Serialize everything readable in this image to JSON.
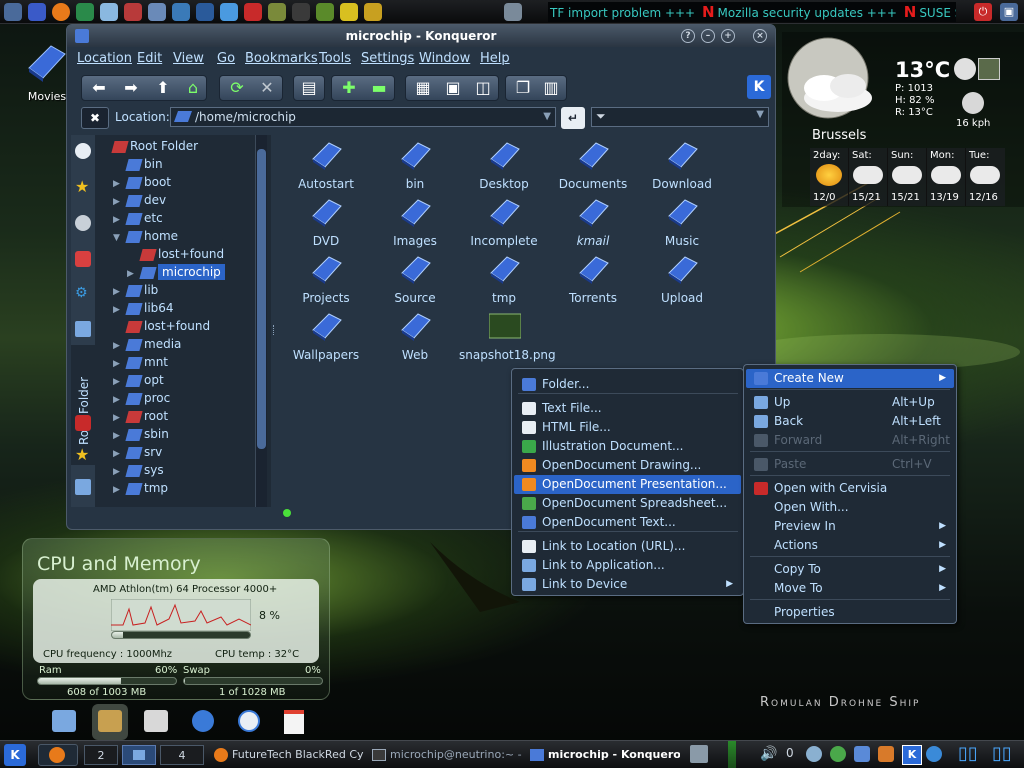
{
  "desktop": {
    "movies_label": "Movies",
    "branding": "Romulan Drohne Ship"
  },
  "topbar": {
    "ticker_prefix": "TF import problem +++",
    "ticker_items": [
      "Mozilla security updates +++",
      "SUSE Security"
    ],
    "ticker_mark": "N"
  },
  "weather": {
    "temperature": "13°C",
    "pressure": "P: 1013",
    "humidity": "H: 82 %",
    "realfeel": "R: 13°C",
    "wind": "16 kph",
    "city": "Brussels",
    "forecast": [
      {
        "day": "2day:",
        "temps": "12/0"
      },
      {
        "day": "Sat:",
        "temps": "15/21"
      },
      {
        "day": "Sun:",
        "temps": "15/21"
      },
      {
        "day": "Mon:",
        "temps": "13/19"
      },
      {
        "day": "Tue:",
        "temps": "12/16"
      }
    ]
  },
  "konqueror": {
    "title": "microchip - Konqueror",
    "menus": [
      "Location",
      "Edit",
      "View",
      "Go",
      "Bookmarks",
      "Tools",
      "Settings",
      "Window",
      "Help"
    ],
    "location_label": "Location:",
    "location_value": "/home/microchip",
    "sidebar_tab": "Root Folder",
    "tree": [
      {
        "label": "Root Folder",
        "level": 0,
        "arrow": ""
      },
      {
        "label": "bin",
        "level": 1,
        "arrow": ""
      },
      {
        "label": "boot",
        "level": 1,
        "arrow": "▶"
      },
      {
        "label": "dev",
        "level": 1,
        "arrow": "▶"
      },
      {
        "label": "etc",
        "level": 1,
        "arrow": "▶"
      },
      {
        "label": "home",
        "level": 1,
        "arrow": "▼"
      },
      {
        "label": "lost+found",
        "level": 2,
        "arrow": ""
      },
      {
        "label": "microchip",
        "level": 2,
        "arrow": "▶"
      },
      {
        "label": "lib",
        "level": 1,
        "arrow": "▶"
      },
      {
        "label": "lib64",
        "level": 1,
        "arrow": "▶"
      },
      {
        "label": "lost+found",
        "level": 1,
        "arrow": ""
      },
      {
        "label": "media",
        "level": 1,
        "arrow": "▶"
      },
      {
        "label": "mnt",
        "level": 1,
        "arrow": "▶"
      },
      {
        "label": "opt",
        "level": 1,
        "arrow": "▶"
      },
      {
        "label": "proc",
        "level": 1,
        "arrow": "▶"
      },
      {
        "label": "root",
        "level": 1,
        "arrow": "▶"
      },
      {
        "label": "sbin",
        "level": 1,
        "arrow": "▶"
      },
      {
        "label": "srv",
        "level": 1,
        "arrow": "▶"
      },
      {
        "label": "sys",
        "level": 1,
        "arrow": "▶"
      },
      {
        "label": "tmp",
        "level": 1,
        "arrow": "▶"
      }
    ],
    "files": [
      "Autostart",
      "bin",
      "Desktop",
      "Documents",
      "Download",
      "DVD",
      "Images",
      "Incomplete",
      "kmail",
      "Music",
      "Projects",
      "Source",
      "tmp",
      "Torrents",
      "Upload",
      "Wallpapers",
      "Web",
      "snapshot18.png"
    ]
  },
  "context_menu": {
    "items": [
      {
        "label": "Create New",
        "shortcut": "",
        "submenu": true,
        "disabled": false,
        "selected": true
      },
      {
        "label": "Up",
        "shortcut": "Alt+Up",
        "submenu": false,
        "disabled": false
      },
      {
        "label": "Back",
        "shortcut": "Alt+Left",
        "submenu": false,
        "disabled": false
      },
      {
        "label": "Forward",
        "shortcut": "Alt+Right",
        "submenu": false,
        "disabled": true
      },
      {
        "label": "Paste",
        "shortcut": "Ctrl+V",
        "submenu": false,
        "disabled": true
      },
      {
        "label": "Open with Cervisia",
        "shortcut": "",
        "submenu": false,
        "disabled": false
      },
      {
        "label": "Open With...",
        "shortcut": "",
        "submenu": false,
        "disabled": false
      },
      {
        "label": "Preview In",
        "shortcut": "",
        "submenu": true,
        "disabled": false
      },
      {
        "label": "Actions",
        "shortcut": "",
        "submenu": true,
        "disabled": false
      },
      {
        "label": "Copy To",
        "shortcut": "",
        "submenu": true,
        "disabled": false
      },
      {
        "label": "Move To",
        "shortcut": "",
        "submenu": true,
        "disabled": false
      },
      {
        "label": "Properties",
        "shortcut": "",
        "submenu": false,
        "disabled": false
      }
    ]
  },
  "create_new_menu": {
    "items": [
      "Folder...",
      "Text File...",
      "HTML File...",
      "Illustration Document...",
      "OpenDocument Drawing...",
      "OpenDocument Presentation...",
      "OpenDocument Spreadsheet...",
      "OpenDocument Text...",
      "Link to Location (URL)...",
      "Link to Application...",
      "Link to Device"
    ],
    "selected_index": 5
  },
  "cpu_widget": {
    "title": "CPU and Memory",
    "processor": "AMD Athlon(tm) 64 Processor 4000+",
    "cpu_percent": "8 %",
    "cpu_frequency": "CPU frequency : 1000Mhz",
    "cpu_temp": "CPU temp : 32°C",
    "ram_label": "Ram",
    "ram_percent": "60%",
    "ram_usage": "608 of 1003 MB",
    "ram_fraction": 0.6,
    "swap_label": "Swap",
    "swap_percent": "0%",
    "swap_usage": "1 of 1028 MB",
    "swap_fraction": 0.0
  },
  "taskbar": {
    "desktops": [
      "2",
      "4"
    ],
    "tasks": [
      "FutureTech BlackRed Cyl",
      "microchip@neutrino:~ - Sh",
      "microchip - Konqueror"
    ]
  },
  "colors": {
    "accent": "#2b64c8",
    "window_bg": "#263443",
    "ticker_text": "#38c8c0",
    "ticker_mark": "#e51c1c"
  }
}
